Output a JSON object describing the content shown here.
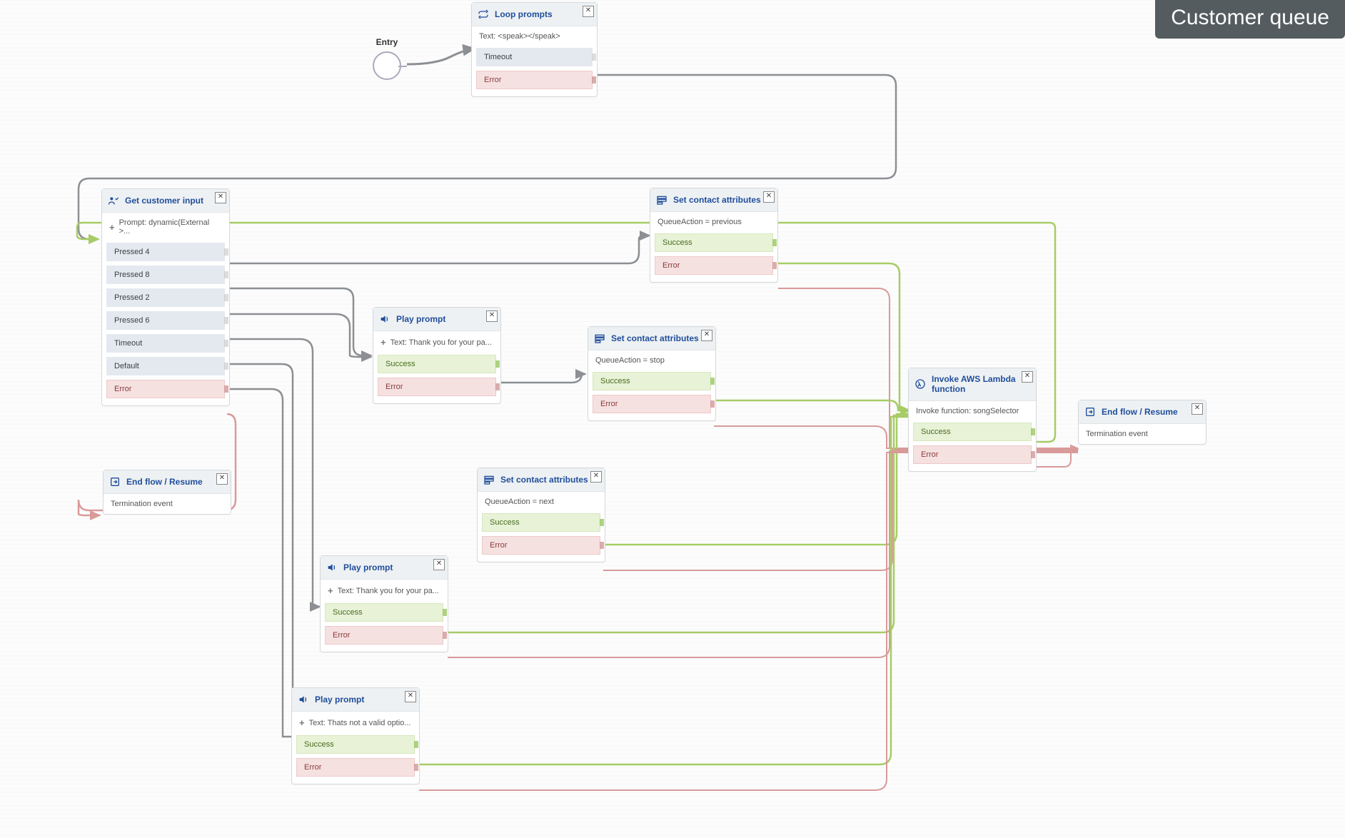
{
  "page": {
    "title": "Customer queue"
  },
  "entry": {
    "label": "Entry"
  },
  "blocks": {
    "loop_prompts": {
      "title": "Loop prompts",
      "body": "Text: <speak></speak>",
      "branches": [
        {
          "label": "Timeout",
          "kind": "neutral"
        },
        {
          "label": "Error",
          "kind": "error"
        }
      ]
    },
    "get_customer_input": {
      "title": "Get customer input",
      "body": "Prompt: dynamic(External >...",
      "branches": [
        {
          "label": "Pressed 4",
          "kind": "neutral"
        },
        {
          "label": "Pressed 8",
          "kind": "neutral"
        },
        {
          "label": "Pressed 2",
          "kind": "neutral"
        },
        {
          "label": "Pressed 6",
          "kind": "neutral"
        },
        {
          "label": "Timeout",
          "kind": "neutral"
        },
        {
          "label": "Default",
          "kind": "neutral"
        },
        {
          "label": "Error",
          "kind": "error"
        }
      ]
    },
    "end_flow_left": {
      "title": "End flow / Resume",
      "body": "Termination event"
    },
    "play_prompt_1": {
      "title": "Play prompt",
      "body": "Text: Thank you for your pa...",
      "branches": [
        {
          "label": "Success",
          "kind": "success"
        },
        {
          "label": "Error",
          "kind": "error"
        }
      ]
    },
    "play_prompt_2": {
      "title": "Play prompt",
      "body": "Text: Thank you for your pa...",
      "branches": [
        {
          "label": "Success",
          "kind": "success"
        },
        {
          "label": "Error",
          "kind": "error"
        }
      ]
    },
    "play_prompt_3": {
      "title": "Play prompt",
      "body": "Text: Thats not a valid optio...",
      "branches": [
        {
          "label": "Success",
          "kind": "success"
        },
        {
          "label": "Error",
          "kind": "error"
        }
      ]
    },
    "set_attr_prev": {
      "title": "Set contact attributes",
      "body": "QueueAction = previous",
      "branches": [
        {
          "label": "Success",
          "kind": "success"
        },
        {
          "label": "Error",
          "kind": "error"
        }
      ]
    },
    "set_attr_stop": {
      "title": "Set contact attributes",
      "body": "QueueAction = stop",
      "branches": [
        {
          "label": "Success",
          "kind": "success"
        },
        {
          "label": "Error",
          "kind": "error"
        }
      ]
    },
    "set_attr_next": {
      "title": "Set contact attributes",
      "body": "QueueAction = next",
      "branches": [
        {
          "label": "Success",
          "kind": "success"
        },
        {
          "label": "Error",
          "kind": "error"
        }
      ]
    },
    "invoke_lambda": {
      "title": "Invoke AWS Lambda function",
      "body": "Invoke function: songSelector",
      "branches": [
        {
          "label": "Success",
          "kind": "success"
        },
        {
          "label": "Error",
          "kind": "error"
        }
      ]
    },
    "end_flow_right": {
      "title": "End flow / Resume",
      "body": "Termination event"
    }
  }
}
